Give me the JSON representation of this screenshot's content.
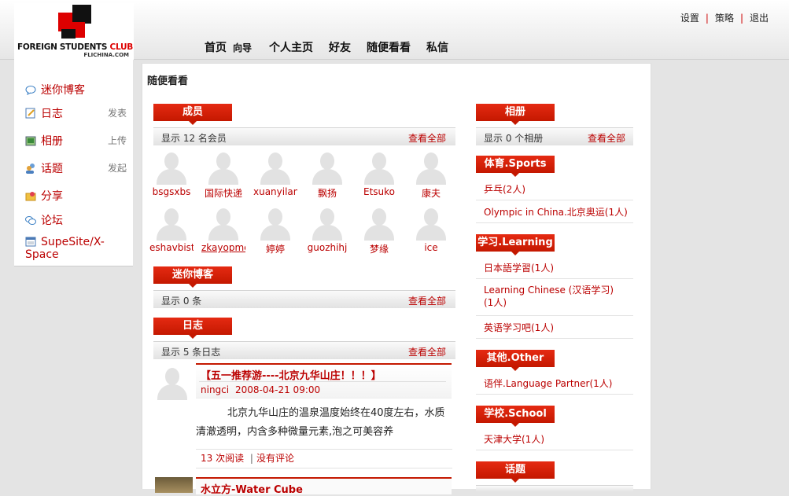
{
  "brand": {
    "logo_text_main": "FOREIGN STUDENTS",
    "logo_text_accent": "CLUB",
    "logo_sub": "FLICHINA.COM"
  },
  "top_links": [
    "设置",
    "策略",
    "退出"
  ],
  "nav": [
    "首页",
    "向导",
    "个人主页",
    "好友",
    "随便看看",
    "私信"
  ],
  "sidebar": {
    "items": [
      {
        "label": "迷你博客",
        "icon": "speech-bubble-icon",
        "action": ""
      },
      {
        "label": "日志",
        "icon": "notepad-icon",
        "action": "发表"
      },
      {
        "label": "相册",
        "icon": "picture-icon",
        "action": "上传"
      },
      {
        "label": "话题",
        "icon": "users-icon",
        "action": "发起"
      },
      {
        "label": "分享",
        "icon": "folder-icon",
        "action": ""
      },
      {
        "label": "论坛",
        "icon": "chat-bubbles-icon",
        "action": ""
      },
      {
        "label": "SupeSite/X-Space",
        "icon": "window-icon",
        "action": ""
      }
    ]
  },
  "main": {
    "title": "随便看看",
    "members": {
      "tab": "成员",
      "count_text": "显示 12 名会员",
      "view_all": "查看全部",
      "names": [
        "bsgsxbs",
        "国际快递",
        "xuanyilang",
        "飘扬",
        "Etsuko",
        "康夫",
        "eshavbist",
        "zkayopme",
        "婷婷",
        "guozhihj",
        "梦缘",
        "ice"
      ]
    },
    "miniblog": {
      "tab": "迷你博客",
      "count_text": "显示 0 条",
      "view_all": "查看全部"
    },
    "blog": {
      "tab": "日志",
      "count_text": "显示 5 条日志",
      "view_all": "查看全部",
      "entries": [
        {
          "title": "【五一推荐游----北京九华山庄！！！】",
          "author": "ningci",
          "date": "2008-04-21 09:00",
          "body": "北京九华山庄的温泉温度始终在40度左右，水质清澈透明，内含多种微量元素,泡之可美容养",
          "reads": "13 次阅读",
          "comments": "没有评论"
        },
        {
          "title": "水立方-Water Cube"
        }
      ]
    }
  },
  "right": {
    "album": {
      "tab": "相册",
      "count_text": "显示 0 个相册",
      "view_all": "查看全部"
    },
    "categories": [
      {
        "tab": "体育.Sports",
        "items": [
          "乒乓(2人)",
          "Olympic in China.北京奥运(1人)"
        ]
      },
      {
        "tab": "学习.Learning",
        "items": [
          "日本語学習(1人)",
          "Learning Chinese (汉语学习)(1人)",
          "英语学习吧(1人)"
        ]
      },
      {
        "tab": "其他.Other",
        "items": [
          "语伴.Language Partner(1人)"
        ]
      },
      {
        "tab": "学校.School",
        "items": [
          "天津大学(1人)"
        ]
      }
    ],
    "topic": {
      "tab": "话题"
    }
  },
  "colors": {
    "accent": "#c41800",
    "link": "#bb0000",
    "bg": "#e4e4e4"
  }
}
